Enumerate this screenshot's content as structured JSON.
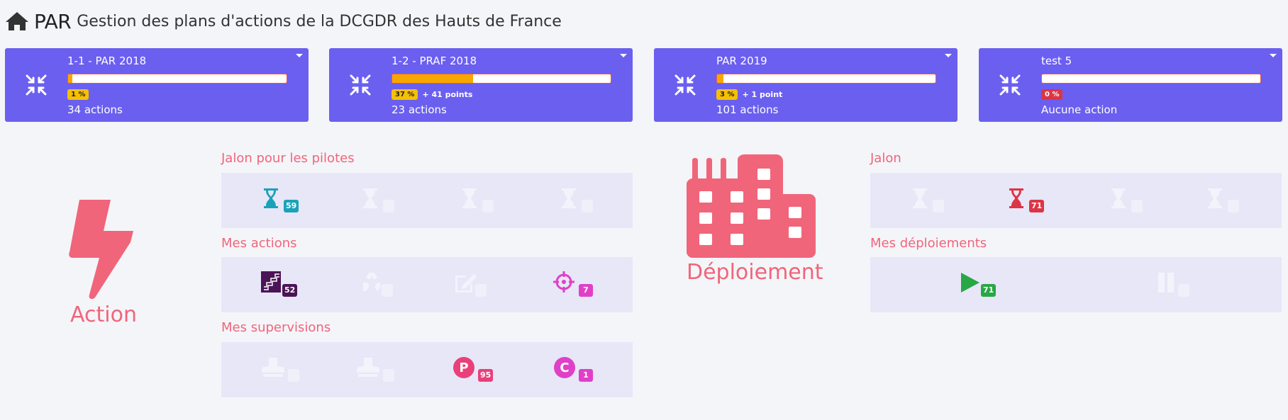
{
  "header": {
    "app_name": "PAR",
    "subtitle": "Gestion des plans d'actions de la DCGDR des Hauts de France"
  },
  "plans": [
    {
      "name": "1-1 - PAR 2018",
      "progress_pct": 1,
      "badge": "1 %",
      "points": "",
      "actions": "34 actions"
    },
    {
      "name": "1-2 - PRAF 2018",
      "progress_pct": 37,
      "badge": "37 %",
      "points": "+ 41 points",
      "actions": "23 actions"
    },
    {
      "name": "PAR 2019",
      "progress_pct": 3,
      "badge": "3 %",
      "points": "+ 1 point",
      "actions": "101 actions"
    },
    {
      "name": "test 5",
      "progress_pct": 0,
      "badge": "0 %",
      "points": "",
      "actions": "Aucune action"
    }
  ],
  "action": {
    "label": "Action",
    "icon": "bolt-icon",
    "jalon_pilotes": {
      "title": "Jalon pour les pilotes",
      "counts": [
        "59",
        "",
        "",
        ""
      ],
      "icon": "hourglass-icon"
    },
    "mes_actions": {
      "title": "Mes actions",
      "counts": [
        "52",
        "",
        "",
        "7"
      ],
      "icons": [
        "stairs-icon",
        "recycle-icon",
        "edit-icon",
        "crosshairs-icon"
      ]
    },
    "mes_supervisions": {
      "title": "Mes supervisions",
      "counts": [
        "",
        "",
        "95",
        "1"
      ],
      "icons": [
        "stamp-icon",
        "stamp-icon",
        "p-circle-icon",
        "c-circle-icon"
      ]
    }
  },
  "deploiement": {
    "label": "Déploiement",
    "icon": "building-icon",
    "jalon": {
      "title": "Jalon",
      "counts": [
        "",
        "71",
        "",
        ""
      ],
      "icon": "hourglass-icon"
    },
    "mes_deploiements": {
      "title": "Mes déploiements",
      "counts": [
        "71",
        ""
      ],
      "icons": [
        "play-icon",
        "pause-icon"
      ]
    }
  },
  "colors": {
    "card_bg": "#6b5ff0",
    "accent": "#f0657a",
    "teal": "#1aa3b8",
    "red": "#dc3545",
    "purple": "#4b1456",
    "magenta": "#e040c8",
    "pink": "#e9407a",
    "green": "#28a745",
    "faded": "#f3f3fb"
  }
}
